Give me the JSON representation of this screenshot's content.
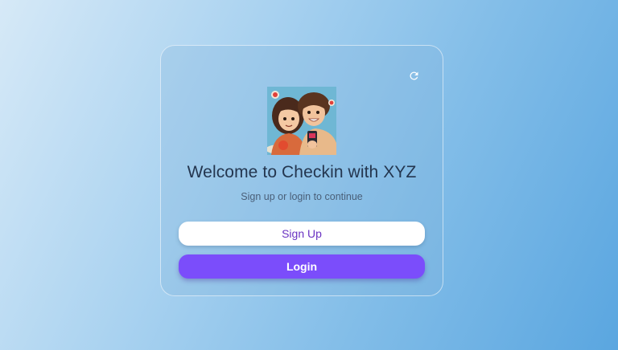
{
  "card": {
    "title": "Welcome to Checkin with XYZ",
    "subtitle": "Sign up or login to continue"
  },
  "buttons": {
    "signup_label": "Sign Up",
    "login_label": "Login"
  },
  "icons": {
    "refresh": "refresh-icon",
    "avatar": "couple-selfie-avatar"
  },
  "colors": {
    "accent": "#7b4dfb",
    "signup_text": "#6a33c2",
    "title_text": "#24364f",
    "subtitle_text": "#4a5f78"
  }
}
